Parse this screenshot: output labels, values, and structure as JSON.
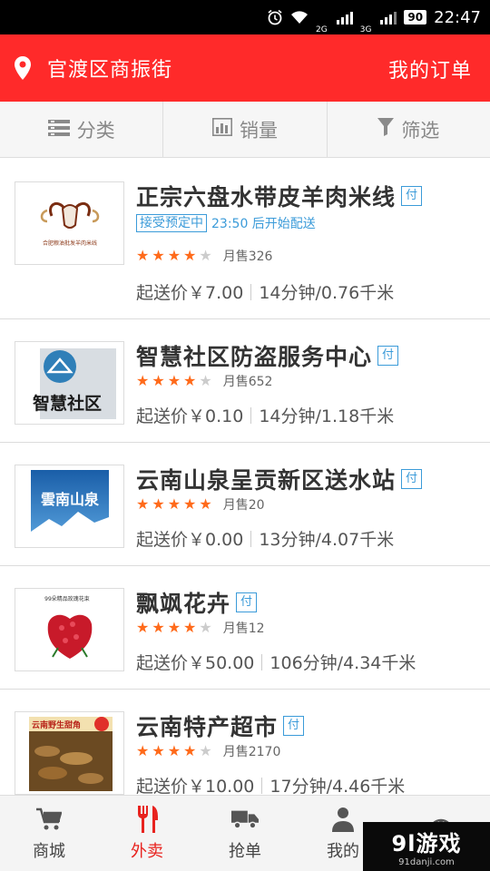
{
  "status_bar": {
    "battery": "90",
    "net1": "2G",
    "net2": "3G",
    "time": "22:47"
  },
  "header": {
    "location": "官渡区商振街",
    "orders": "我的订单"
  },
  "tabs": [
    {
      "label": "分类",
      "icon": "list-icon"
    },
    {
      "label": "销量",
      "icon": "bar-chart-icon"
    },
    {
      "label": "筛选",
      "icon": "filter-icon"
    }
  ],
  "shops": [
    {
      "name": "正宗六盘水带皮羊肉米线",
      "pay": "付",
      "preorder_badge": "接受预定中",
      "preorder_text": "23:50 后开始配送",
      "stars": 4,
      "sales": "月售326",
      "min_price": "起送价￥7.00",
      "delivery": "14分钟/0.76千米",
      "thumb_text": "合肥粮油批发羊肉米线"
    },
    {
      "name": "智慧社区防盗服务中心",
      "pay": "付",
      "stars": 4,
      "sales": "月售652",
      "min_price": "起送价￥0.10",
      "delivery": "14分钟/1.18千米",
      "thumb_text": "智慧社区"
    },
    {
      "name": "云南山泉呈贡新区送水站",
      "pay": "付",
      "stars": 5,
      "sales": "月售20",
      "min_price": "起送价￥0.00",
      "delivery": "13分钟/4.07千米",
      "thumb_text": "雲南山泉"
    },
    {
      "name": "飘飒花卉",
      "pay": "付",
      "stars": 4,
      "sales": "月售12",
      "min_price": "起送价￥50.00",
      "delivery": "106分钟/4.34千米",
      "thumb_text": "99朵精品玫瑰花束"
    },
    {
      "name": "云南特产超市",
      "pay": "付",
      "stars": 4,
      "sales": "月售2170",
      "min_price": "起送价￥10.00",
      "delivery": "17分钟/4.46千米",
      "thumb_text": "云南野生甜角"
    }
  ],
  "bottom_nav": [
    {
      "label": "商城",
      "icon": "cart-icon"
    },
    {
      "label": "外卖",
      "icon": "fork-knife-icon",
      "active": true
    },
    {
      "label": "抢单",
      "icon": "truck-icon"
    },
    {
      "label": "我的",
      "icon": "person-icon"
    },
    {
      "label": "",
      "icon": "globe-icon"
    }
  ],
  "watermark": {
    "logo": "9l游戏",
    "url": "91danji.com"
  },
  "colors": {
    "brand_red": "#ff2a2a",
    "active_red": "#e8231f",
    "star_orange": "#ff6a1a",
    "badge_blue": "#3b9bd9"
  }
}
